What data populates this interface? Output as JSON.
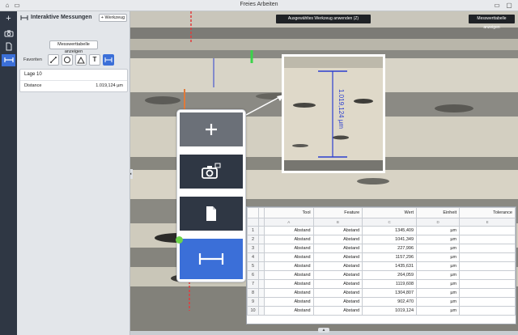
{
  "window": {
    "title": "Freies Arbeiten"
  },
  "panel": {
    "title": "Interaktive Messungen",
    "add_button": "+ Werkzeug",
    "messwerttabelle_button": "Messwerttabelle anzeigen",
    "favoriten_label": "Favoriten",
    "tools": [
      "line-icon",
      "circle-icon",
      "angle-icon",
      "text-icon",
      "distance-icon"
    ],
    "measurement": {
      "name": "Lage 10",
      "label": "Distance",
      "value": "1.019,124 µm"
    }
  },
  "viewport": {
    "overlay_top": "Ausgewähltes Werkzeug anwenden (Z)",
    "overlay_right": "Messwerttabelle anzeigen",
    "zoomed_label": "1.019,124 µm"
  },
  "zoom_icons": [
    "plus-icon",
    "camera-icon",
    "document-icon",
    "distance-icon"
  ],
  "table": {
    "headers": [
      "Tool",
      "Feature",
      "Wert",
      "Einheit",
      "Tolerance"
    ],
    "subheaders": [
      "A",
      "B",
      "C",
      "D",
      "E"
    ],
    "rows": [
      {
        "n": "1",
        "tool": "Abstand",
        "feature": "Abstand",
        "wert": "1345,409",
        "einheit": "µm",
        "tol": ""
      },
      {
        "n": "2",
        "tool": "Abstand",
        "feature": "Abstand",
        "wert": "1041,349",
        "einheit": "µm",
        "tol": ""
      },
      {
        "n": "3",
        "tool": "Abstand",
        "feature": "Abstand",
        "wert": "227,996",
        "einheit": "µm",
        "tol": ""
      },
      {
        "n": "4",
        "tool": "Abstand",
        "feature": "Abstand",
        "wert": "1157,296",
        "einheit": "µm",
        "tol": ""
      },
      {
        "n": "5",
        "tool": "Abstand",
        "feature": "Abstand",
        "wert": "1435,631",
        "einheit": "µm",
        "tol": ""
      },
      {
        "n": "6",
        "tool": "Abstand",
        "feature": "Abstand",
        "wert": "264,059",
        "einheit": "µm",
        "tol": ""
      },
      {
        "n": "7",
        "tool": "Abstand",
        "feature": "Abstand",
        "wert": "1119,608",
        "einheit": "µm",
        "tol": ""
      },
      {
        "n": "8",
        "tool": "Abstand",
        "feature": "Abstand",
        "wert": "1304,807",
        "einheit": "µm",
        "tol": ""
      },
      {
        "n": "9",
        "tool": "Abstand",
        "feature": "Abstand",
        "wert": "902,470",
        "einheit": "µm",
        "tol": ""
      },
      {
        "n": "10",
        "tool": "Abstand",
        "feature": "Abstand",
        "wert": "1019,124",
        "einheit": "µm",
        "tol": ""
      }
    ]
  },
  "colors": {
    "accent": "#3b6fd8",
    "iconbar": "#2f3744",
    "measure_line": "#2b3fd0"
  }
}
